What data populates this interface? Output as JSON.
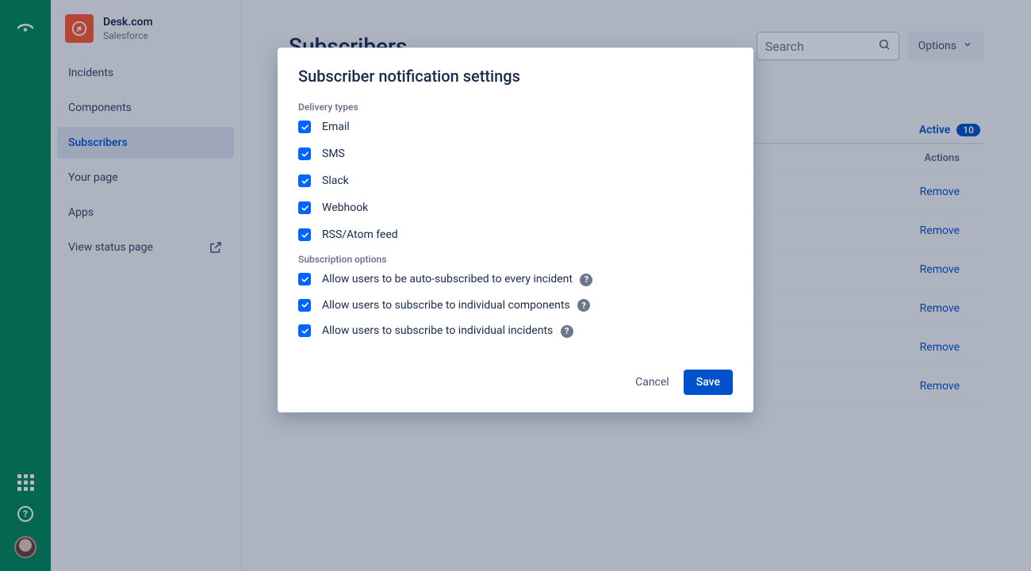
{
  "brand": {
    "title": "Desk.com",
    "subtitle": "Salesforce"
  },
  "sidebar": {
    "items": [
      {
        "label": "Incidents"
      },
      {
        "label": "Components"
      },
      {
        "label": "Subscribers"
      },
      {
        "label": "Your page"
      },
      {
        "label": "Apps"
      },
      {
        "label": "View status page"
      }
    ]
  },
  "page": {
    "title": "Subscribers",
    "search_placeholder": "Search",
    "options_label": "Options"
  },
  "tabs": {
    "active_label": "Active",
    "active_count": "10"
  },
  "table": {
    "actions_header": "Actions",
    "remove_label": "Remove",
    "row_count": 6
  },
  "modal": {
    "title": "Subscriber notification settings",
    "delivery_label": "Delivery types",
    "delivery_types": [
      {
        "label": "Email"
      },
      {
        "label": "SMS"
      },
      {
        "label": "Slack"
      },
      {
        "label": "Webhook"
      },
      {
        "label": "RSS/Atom feed"
      }
    ],
    "subscription_label": "Subscription options",
    "subscription_options": [
      {
        "label": "Allow users to be auto-subscribed to every incident",
        "help": true
      },
      {
        "label": "Allow users to subscribe to individual components",
        "help": true
      },
      {
        "label": "Allow users to subscribe to individual incidents",
        "help": true
      }
    ],
    "cancel_label": "Cancel",
    "save_label": "Save"
  }
}
